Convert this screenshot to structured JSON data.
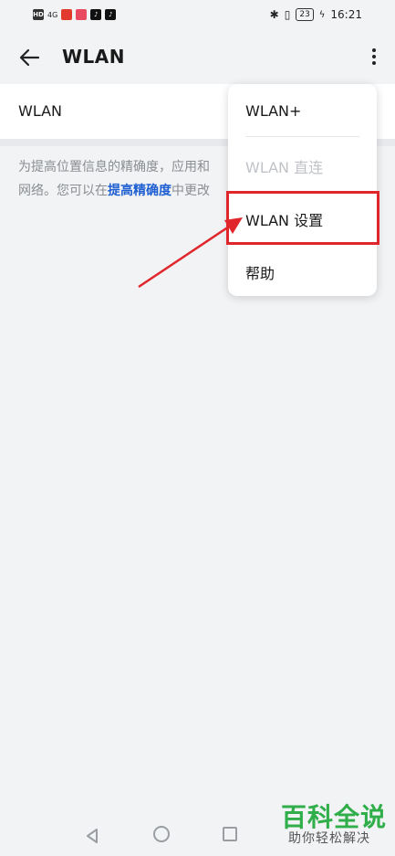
{
  "status_bar": {
    "indicators": [
      "HD",
      "4G"
    ],
    "time": "16:21",
    "battery": "23"
  },
  "app_bar": {
    "title": "WLAN",
    "back_icon": "arrow-left-icon",
    "more_icon": "more-vertical-icon"
  },
  "wlan_row": {
    "label": "WLAN"
  },
  "description": {
    "text_1": "为提高位置信息的精确度，应用和",
    "text_2_prefix": "网络。您可以在",
    "link": "提高精确度",
    "text_2_suffix": "中更改"
  },
  "menu": {
    "items": [
      {
        "label": "WLAN+"
      },
      {
        "label": "WLAN 直连",
        "disabled": true
      },
      {
        "label": "WLAN 设置",
        "highlighted": true
      },
      {
        "label": "帮助"
      }
    ]
  },
  "annotation": {
    "highlight_color": "#e0262a"
  },
  "watermark": {
    "title": "百科全说",
    "subtitle": "助你轻松解决"
  }
}
